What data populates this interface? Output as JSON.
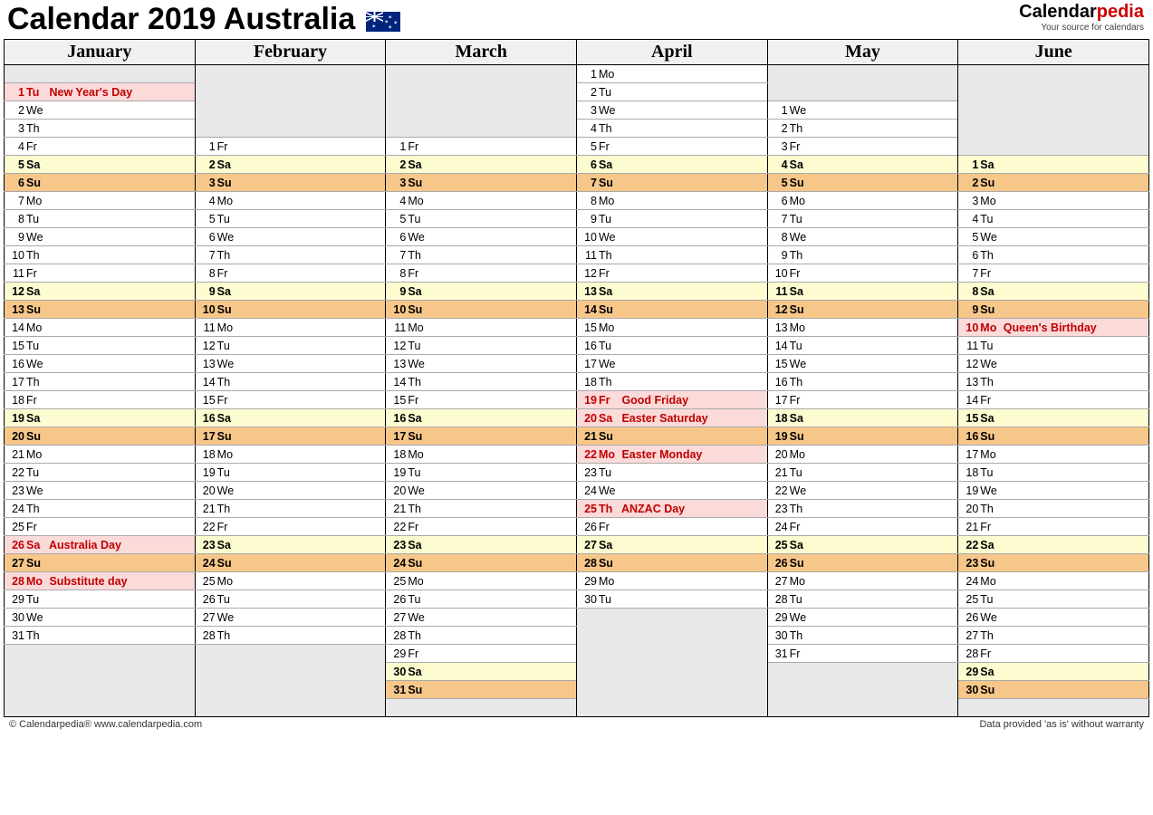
{
  "title": "Calendar 2019 Australia",
  "brand_name_a": "Calendar",
  "brand_name_b": "pedia",
  "brand_tag": "Your source for calendars",
  "footer_left": "© Calendarpedia®   www.calendarpedia.com",
  "footer_right": "Data provided 'as is' without warranty",
  "months": [
    "January",
    "February",
    "March",
    "April",
    "May",
    "June"
  ],
  "rows": 36,
  "columns": [
    {
      "month": "January",
      "offset": 1,
      "days": [
        {
          "n": 1,
          "d": "Tu",
          "hol": "New Year's Day"
        },
        {
          "n": 2,
          "d": "We"
        },
        {
          "n": 3,
          "d": "Th"
        },
        {
          "n": 4,
          "d": "Fr"
        },
        {
          "n": 5,
          "d": "Sa"
        },
        {
          "n": 6,
          "d": "Su"
        },
        {
          "n": 7,
          "d": "Mo"
        },
        {
          "n": 8,
          "d": "Tu"
        },
        {
          "n": 9,
          "d": "We"
        },
        {
          "n": 10,
          "d": "Th"
        },
        {
          "n": 11,
          "d": "Fr"
        },
        {
          "n": 12,
          "d": "Sa"
        },
        {
          "n": 13,
          "d": "Su"
        },
        {
          "n": 14,
          "d": "Mo"
        },
        {
          "n": 15,
          "d": "Tu"
        },
        {
          "n": 16,
          "d": "We"
        },
        {
          "n": 17,
          "d": "Th"
        },
        {
          "n": 18,
          "d": "Fr"
        },
        {
          "n": 19,
          "d": "Sa"
        },
        {
          "n": 20,
          "d": "Su"
        },
        {
          "n": 21,
          "d": "Mo"
        },
        {
          "n": 22,
          "d": "Tu"
        },
        {
          "n": 23,
          "d": "We"
        },
        {
          "n": 24,
          "d": "Th"
        },
        {
          "n": 25,
          "d": "Fr"
        },
        {
          "n": 26,
          "d": "Sa",
          "hol": "Australia Day"
        },
        {
          "n": 27,
          "d": "Su"
        },
        {
          "n": 28,
          "d": "Mo",
          "hol": "Substitute day"
        },
        {
          "n": 29,
          "d": "Tu"
        },
        {
          "n": 30,
          "d": "We"
        },
        {
          "n": 31,
          "d": "Th"
        }
      ]
    },
    {
      "month": "February",
      "offset": 4,
      "days": [
        {
          "n": 1,
          "d": "Fr"
        },
        {
          "n": 2,
          "d": "Sa"
        },
        {
          "n": 3,
          "d": "Su"
        },
        {
          "n": 4,
          "d": "Mo"
        },
        {
          "n": 5,
          "d": "Tu"
        },
        {
          "n": 6,
          "d": "We"
        },
        {
          "n": 7,
          "d": "Th"
        },
        {
          "n": 8,
          "d": "Fr"
        },
        {
          "n": 9,
          "d": "Sa"
        },
        {
          "n": 10,
          "d": "Su"
        },
        {
          "n": 11,
          "d": "Mo"
        },
        {
          "n": 12,
          "d": "Tu"
        },
        {
          "n": 13,
          "d": "We"
        },
        {
          "n": 14,
          "d": "Th"
        },
        {
          "n": 15,
          "d": "Fr"
        },
        {
          "n": 16,
          "d": "Sa"
        },
        {
          "n": 17,
          "d": "Su"
        },
        {
          "n": 18,
          "d": "Mo"
        },
        {
          "n": 19,
          "d": "Tu"
        },
        {
          "n": 20,
          "d": "We"
        },
        {
          "n": 21,
          "d": "Th"
        },
        {
          "n": 22,
          "d": "Fr"
        },
        {
          "n": 23,
          "d": "Sa"
        },
        {
          "n": 24,
          "d": "Su"
        },
        {
          "n": 25,
          "d": "Mo"
        },
        {
          "n": 26,
          "d": "Tu"
        },
        {
          "n": 27,
          "d": "We"
        },
        {
          "n": 28,
          "d": "Th"
        }
      ]
    },
    {
      "month": "March",
      "offset": 4,
      "days": [
        {
          "n": 1,
          "d": "Fr"
        },
        {
          "n": 2,
          "d": "Sa"
        },
        {
          "n": 3,
          "d": "Su"
        },
        {
          "n": 4,
          "d": "Mo"
        },
        {
          "n": 5,
          "d": "Tu"
        },
        {
          "n": 6,
          "d": "We"
        },
        {
          "n": 7,
          "d": "Th"
        },
        {
          "n": 8,
          "d": "Fr"
        },
        {
          "n": 9,
          "d": "Sa"
        },
        {
          "n": 10,
          "d": "Su"
        },
        {
          "n": 11,
          "d": "Mo"
        },
        {
          "n": 12,
          "d": "Tu"
        },
        {
          "n": 13,
          "d": "We"
        },
        {
          "n": 14,
          "d": "Th"
        },
        {
          "n": 15,
          "d": "Fr"
        },
        {
          "n": 16,
          "d": "Sa"
        },
        {
          "n": 17,
          "d": "Su"
        },
        {
          "n": 18,
          "d": "Mo"
        },
        {
          "n": 19,
          "d": "Tu"
        },
        {
          "n": 20,
          "d": "We"
        },
        {
          "n": 21,
          "d": "Th"
        },
        {
          "n": 22,
          "d": "Fr"
        },
        {
          "n": 23,
          "d": "Sa"
        },
        {
          "n": 24,
          "d": "Su"
        },
        {
          "n": 25,
          "d": "Mo"
        },
        {
          "n": 26,
          "d": "Tu"
        },
        {
          "n": 27,
          "d": "We"
        },
        {
          "n": 28,
          "d": "Th"
        },
        {
          "n": 29,
          "d": "Fr"
        },
        {
          "n": 30,
          "d": "Sa"
        },
        {
          "n": 31,
          "d": "Su"
        }
      ]
    },
    {
      "month": "April",
      "offset": 0,
      "days": [
        {
          "n": 1,
          "d": "Mo"
        },
        {
          "n": 2,
          "d": "Tu"
        },
        {
          "n": 3,
          "d": "We"
        },
        {
          "n": 4,
          "d": "Th"
        },
        {
          "n": 5,
          "d": "Fr"
        },
        {
          "n": 6,
          "d": "Sa"
        },
        {
          "n": 7,
          "d": "Su"
        },
        {
          "n": 8,
          "d": "Mo"
        },
        {
          "n": 9,
          "d": "Tu"
        },
        {
          "n": 10,
          "d": "We"
        },
        {
          "n": 11,
          "d": "Th"
        },
        {
          "n": 12,
          "d": "Fr"
        },
        {
          "n": 13,
          "d": "Sa"
        },
        {
          "n": 14,
          "d": "Su"
        },
        {
          "n": 15,
          "d": "Mo"
        },
        {
          "n": 16,
          "d": "Tu"
        },
        {
          "n": 17,
          "d": "We"
        },
        {
          "n": 18,
          "d": "Th"
        },
        {
          "n": 19,
          "d": "Fr",
          "hol": "Good Friday"
        },
        {
          "n": 20,
          "d": "Sa",
          "hol": "Easter Saturday"
        },
        {
          "n": 21,
          "d": "Su"
        },
        {
          "n": 22,
          "d": "Mo",
          "hol": "Easter Monday"
        },
        {
          "n": 23,
          "d": "Tu"
        },
        {
          "n": 24,
          "d": "We"
        },
        {
          "n": 25,
          "d": "Th",
          "hol": "ANZAC Day"
        },
        {
          "n": 26,
          "d": "Fr"
        },
        {
          "n": 27,
          "d": "Sa"
        },
        {
          "n": 28,
          "d": "Su"
        },
        {
          "n": 29,
          "d": "Mo"
        },
        {
          "n": 30,
          "d": "Tu"
        }
      ]
    },
    {
      "month": "May",
      "offset": 2,
      "days": [
        {
          "n": 1,
          "d": "We"
        },
        {
          "n": 2,
          "d": "Th"
        },
        {
          "n": 3,
          "d": "Fr"
        },
        {
          "n": 4,
          "d": "Sa"
        },
        {
          "n": 5,
          "d": "Su"
        },
        {
          "n": 6,
          "d": "Mo"
        },
        {
          "n": 7,
          "d": "Tu"
        },
        {
          "n": 8,
          "d": "We"
        },
        {
          "n": 9,
          "d": "Th"
        },
        {
          "n": 10,
          "d": "Fr"
        },
        {
          "n": 11,
          "d": "Sa"
        },
        {
          "n": 12,
          "d": "Su"
        },
        {
          "n": 13,
          "d": "Mo"
        },
        {
          "n": 14,
          "d": "Tu"
        },
        {
          "n": 15,
          "d": "We"
        },
        {
          "n": 16,
          "d": "Th"
        },
        {
          "n": 17,
          "d": "Fr"
        },
        {
          "n": 18,
          "d": "Sa"
        },
        {
          "n": 19,
          "d": "Su"
        },
        {
          "n": 20,
          "d": "Mo"
        },
        {
          "n": 21,
          "d": "Tu"
        },
        {
          "n": 22,
          "d": "We"
        },
        {
          "n": 23,
          "d": "Th"
        },
        {
          "n": 24,
          "d": "Fr"
        },
        {
          "n": 25,
          "d": "Sa"
        },
        {
          "n": 26,
          "d": "Su"
        },
        {
          "n": 27,
          "d": "Mo"
        },
        {
          "n": 28,
          "d": "Tu"
        },
        {
          "n": 29,
          "d": "We"
        },
        {
          "n": 30,
          "d": "Th"
        },
        {
          "n": 31,
          "d": "Fr"
        }
      ]
    },
    {
      "month": "June",
      "offset": 5,
      "days": [
        {
          "n": 1,
          "d": "Sa"
        },
        {
          "n": 2,
          "d": "Su"
        },
        {
          "n": 3,
          "d": "Mo"
        },
        {
          "n": 4,
          "d": "Tu"
        },
        {
          "n": 5,
          "d": "We"
        },
        {
          "n": 6,
          "d": "Th"
        },
        {
          "n": 7,
          "d": "Fr"
        },
        {
          "n": 8,
          "d": "Sa"
        },
        {
          "n": 9,
          "d": "Su"
        },
        {
          "n": 10,
          "d": "Mo",
          "hol": "Queen's Birthday"
        },
        {
          "n": 11,
          "d": "Tu"
        },
        {
          "n": 12,
          "d": "We"
        },
        {
          "n": 13,
          "d": "Th"
        },
        {
          "n": 14,
          "d": "Fr"
        },
        {
          "n": 15,
          "d": "Sa"
        },
        {
          "n": 16,
          "d": "Su"
        },
        {
          "n": 17,
          "d": "Mo"
        },
        {
          "n": 18,
          "d": "Tu"
        },
        {
          "n": 19,
          "d": "We"
        },
        {
          "n": 20,
          "d": "Th"
        },
        {
          "n": 21,
          "d": "Fr"
        },
        {
          "n": 22,
          "d": "Sa"
        },
        {
          "n": 23,
          "d": "Su"
        },
        {
          "n": 24,
          "d": "Mo"
        },
        {
          "n": 25,
          "d": "Tu"
        },
        {
          "n": 26,
          "d": "We"
        },
        {
          "n": 27,
          "d": "Th"
        },
        {
          "n": 28,
          "d": "Fr"
        },
        {
          "n": 29,
          "d": "Sa"
        },
        {
          "n": 30,
          "d": "Su"
        }
      ]
    }
  ]
}
